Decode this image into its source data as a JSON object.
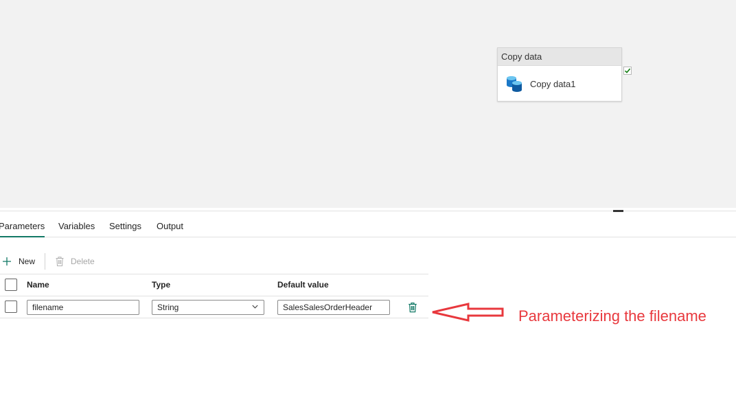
{
  "canvas": {
    "activity": {
      "type_label": "Copy data",
      "name": "Copy data1",
      "icon": "copy-data-icon",
      "status_icon": "checkmark-icon"
    }
  },
  "tabs": [
    {
      "label": "Parameters",
      "active": true
    },
    {
      "label": "Variables",
      "active": false
    },
    {
      "label": "Settings",
      "active": false
    },
    {
      "label": "Output",
      "active": false
    }
  ],
  "toolbar": {
    "new_label": "New",
    "new_icon": "plus-icon",
    "delete_label": "Delete",
    "delete_icon": "trash-icon",
    "delete_enabled": false
  },
  "parameters_table": {
    "columns": [
      "Name",
      "Type",
      "Default value"
    ],
    "rows": [
      {
        "name": "filename",
        "type": "String",
        "default_value": "SalesSalesOrderHeader",
        "checked": false
      }
    ]
  },
  "annotation": {
    "text": "Parameterizing the filename",
    "color": "#e8383d"
  },
  "colors": {
    "accent": "#117865",
    "canvas_background": "#f2f2f2",
    "annotation": "#e8383d"
  }
}
